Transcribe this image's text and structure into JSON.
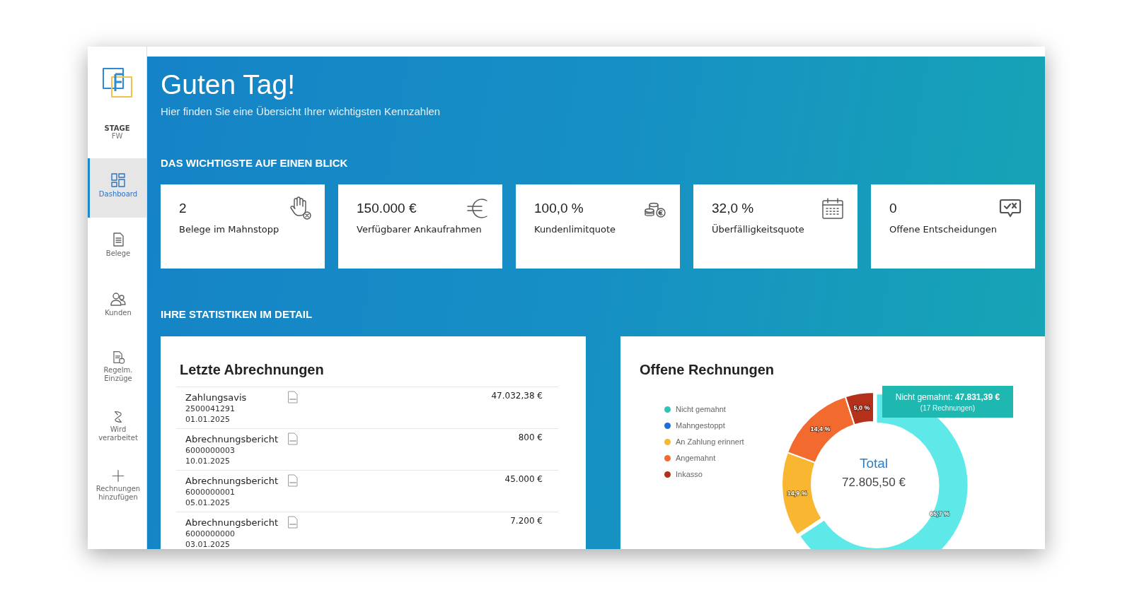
{
  "sidebar": {
    "stage": "STAGE",
    "env": "FW",
    "items": [
      {
        "label": "Dashboard",
        "selected": true
      },
      {
        "label": "Belege",
        "selected": false
      },
      {
        "label": "Kunden",
        "selected": false
      },
      {
        "label": "Regelm. Einzüge",
        "selected": false
      },
      {
        "label": "Wird verarbeitet",
        "selected": false
      },
      {
        "label": "Rechnungen hinzufügen",
        "selected": false
      }
    ]
  },
  "header": {
    "title": "Guten Tag!",
    "subtitle": "Hier finden Sie eine Übersicht Ihrer wichtigsten Kennzahlen"
  },
  "kpi_heading": "DAS WICHTIGSTE AUF EINEN BLICK",
  "kpis": [
    {
      "value": "2",
      "label": "Belege im Mahnstopp"
    },
    {
      "value": "150.000 €",
      "label": "Verfügbarer Ankaufrahmen"
    },
    {
      "value": "100,0 %",
      "label": "Kundenlimitquote"
    },
    {
      "value": "32,0 %",
      "label": "Überfälligkeitsquote"
    },
    {
      "value": "0",
      "label": "Offene Entscheidungen"
    }
  ],
  "stats_heading": "IHRE STATISTIKEN IM DETAIL",
  "settlements": {
    "title": "Letzte Abrechnungen",
    "rows": [
      {
        "name": "Zahlungsavis",
        "number": "2500041291",
        "date": "01.01.2025",
        "amount": "47.032,38 €"
      },
      {
        "name": "Abrechnungsbericht",
        "number": "6000000003",
        "date": "10.01.2025",
        "amount": "800 €"
      },
      {
        "name": "Abrechnungsbericht",
        "number": "6000000001",
        "date": "05.01.2025",
        "amount": "45.000 €"
      },
      {
        "name": "Abrechnungsbericht",
        "number": "6000000000",
        "date": "03.01.2025",
        "amount": "7.200 €"
      }
    ]
  },
  "open_invoices": {
    "legend": [
      {
        "color": "#2ec4b6"
      },
      {
        "color": "#1f6fd6"
      },
      {
        "color": "#f9b731"
      },
      {
        "color": "#f26a2e"
      },
      {
        "color": "#b5301a"
      }
    ],
    "total_label": "Total",
    "total_value": "72.805,50 €",
    "tooltip": {
      "title": "Nicht gemahnt: **47.831,39 €**",
      "subtitle": "(17 Rechnungen)"
    },
    "chart_data": {
      "type": "donut",
      "categories": [
        "Nicht gemahnt",
        "Mahngestoppt",
        "An Zahlung erinnert",
        "Angemahnt",
        "Inkasso"
      ],
      "series": [
        {
          "name": "Offene Rechnungen",
          "values": [
            65.7,
            0,
            14.9,
            14.4,
            5.0
          ]
        }
      ],
      "value_labels": [
        "65,7 %",
        null,
        "14,9 %",
        "14,4 %",
        "5,0 %"
      ]
    }
  }
}
